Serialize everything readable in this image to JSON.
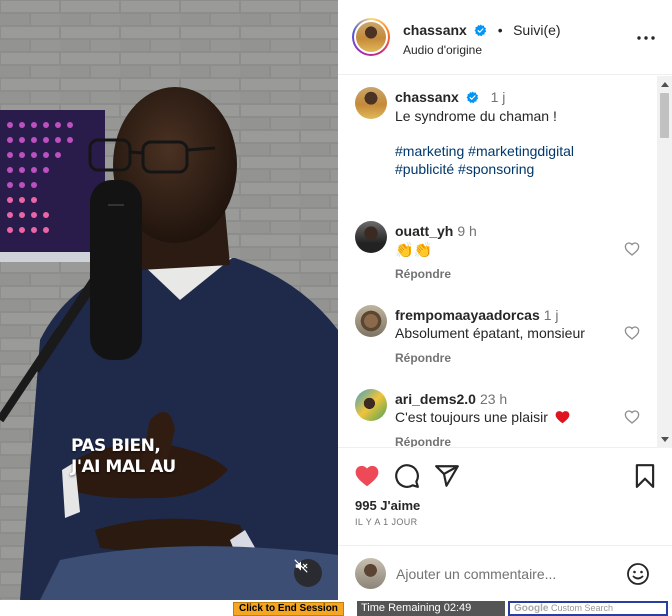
{
  "video": {
    "caption_line1": "PAS BIEN,",
    "caption_line2": "J'AI MAL AU",
    "mute_icon": "speaker-muted-icon"
  },
  "header": {
    "username": "chassanx",
    "separator": "•",
    "follow_label": "Suivi(e)",
    "audio_label": "Audio d'origine",
    "more_icon": "more-horizontal-icon"
  },
  "caption": {
    "username": "chassanx",
    "time": "1 j",
    "text": "Le syndrome du chaman !",
    "hashtags_line1": [
      "#marketing",
      "#marketingdigital"
    ],
    "hashtags_line2": [
      "#publicité",
      "#sponsoring"
    ]
  },
  "comments": [
    {
      "username": "ouatt_yh",
      "time": "9 h",
      "text": "👏👏",
      "reply_label": "Répondre"
    },
    {
      "username": "frempomaayaadorcas",
      "time": "1 j",
      "text": "Absolument épatant, monsieur",
      "reply_label": "Répondre"
    },
    {
      "username": "ari_dems2.0",
      "time": "23 h",
      "text": "C'est toujours une plaisir",
      "reply_label": "Répondre"
    }
  ],
  "actions": {
    "likes": "995 J'aime",
    "date": "IL Y A 1 JOUR",
    "liked": true,
    "like_color": "#ed4956"
  },
  "comment_box": {
    "placeholder": "Ajouter un commentaire..."
  },
  "session_bar": {
    "end_session_label": "Click to End Session",
    "time_remaining": "Time Remaining 02:49",
    "search_brand": "Google",
    "search_suffix": "Custom Search"
  }
}
